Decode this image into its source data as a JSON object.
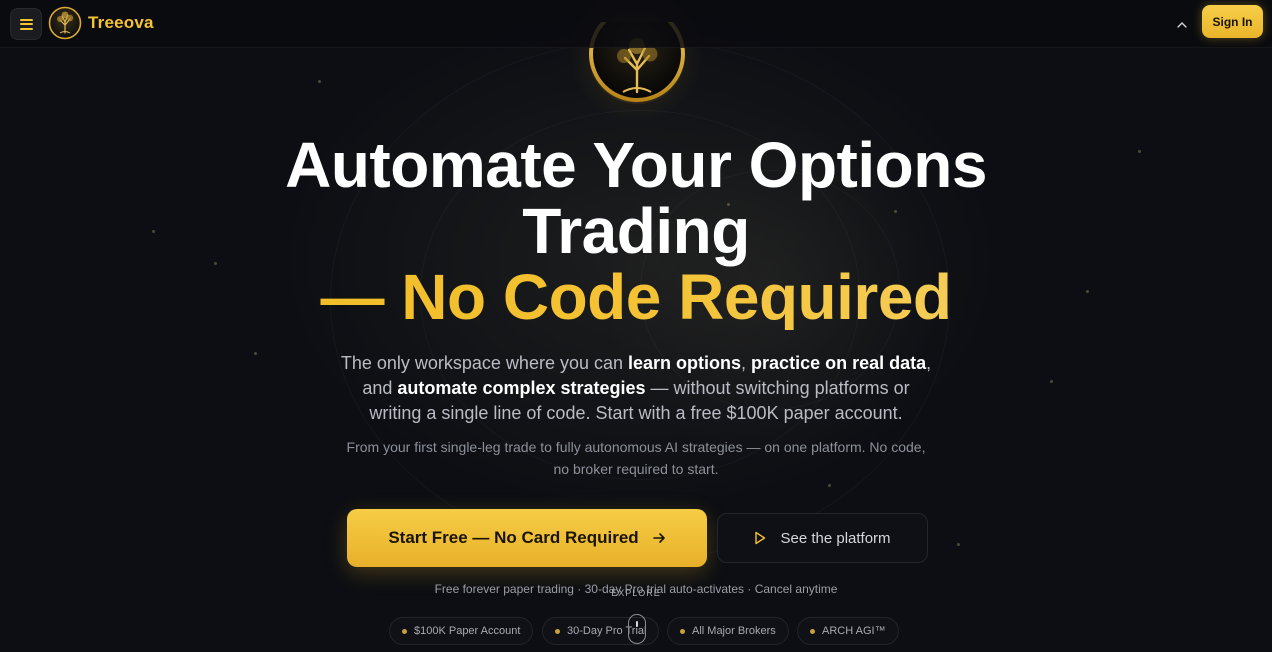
{
  "brand": {
    "name": "Treeova",
    "accent": "#f4c233"
  },
  "header": {
    "menu_icon": "hamburger-icon",
    "caret_icon": "chevron-up-icon",
    "sign_in_label": "Sign In"
  },
  "hero": {
    "headline_line1": "Automate Your Options",
    "headline_line2": "Trading",
    "headline_line3": "— No Code Required",
    "sub_part1": "The only workspace where you can ",
    "sub_bold1": "learn options",
    "sub_part2": ", ",
    "sub_bold2": "practice on real data",
    "sub_part3": ", and ",
    "sub_bold3": "automate complex strategies",
    "sub_part4": " — without switching platforms or writing a single line of code. Start with a free $100K paper account.",
    "secondary_text": "From your first single-leg trade to fully autonomous AI strategies — on one platform. No code, no broker required to start.",
    "cta_primary_label": "Start Free — No Card Required",
    "cta_primary_icon": "arrow-right-icon",
    "cta_secondary_label": "See the platform",
    "cta_secondary_icon": "play-icon",
    "fine_print": "Free forever paper trading · 30-day Pro trial auto-activates · Cancel anytime",
    "explore_label": "EXPLORE"
  },
  "pills": [
    {
      "label": "$100K Paper Account"
    },
    {
      "label": "30-Day Pro Trial"
    },
    {
      "label": "All Major Brokers"
    },
    {
      "label": "ARCH AGI™"
    }
  ]
}
